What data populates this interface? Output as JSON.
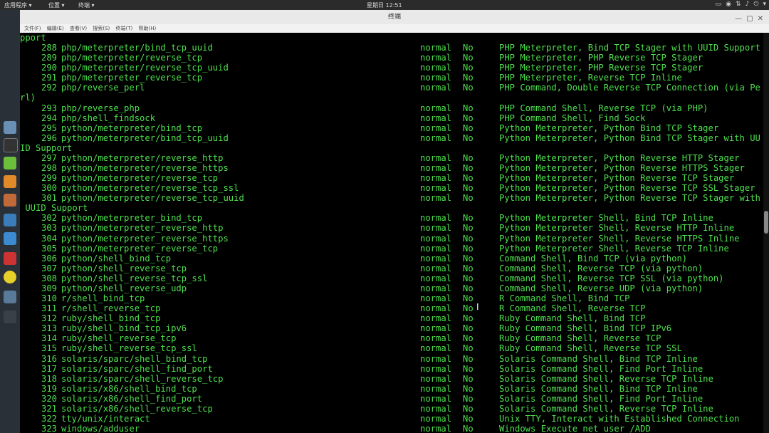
{
  "topbar": {
    "apps": "应用程序 ▾",
    "places": "位置 ▾",
    "terminal": "终端 ▾",
    "clock": "星期日 12:51"
  },
  "window": {
    "title": "终端",
    "menu": [
      "文件(F)",
      "编辑(E)",
      "查看(V)",
      "搜索(S)",
      "终端(T)",
      "帮助(H)"
    ]
  },
  "terminal": {
    "lines": [
      {
        "cont": "pport"
      },
      {
        "num": "288",
        "mod": "php/meterpreter/bind_tcp_uuid",
        "rank": "normal",
        "check": "No",
        "desc": "PHP Meterpreter, Bind TCP Stager with UUID Support"
      },
      {
        "num": "289",
        "mod": "php/meterpreter/reverse_tcp",
        "rank": "normal",
        "check": "No",
        "desc": "PHP Meterpreter, PHP Reverse TCP Stager"
      },
      {
        "num": "290",
        "mod": "php/meterpreter/reverse_tcp_uuid",
        "rank": "normal",
        "check": "No",
        "desc": "PHP Meterpreter, PHP Reverse TCP Stager"
      },
      {
        "num": "291",
        "mod": "php/meterpreter_reverse_tcp",
        "rank": "normal",
        "check": "No",
        "desc": "PHP Meterpreter, Reverse TCP Inline"
      },
      {
        "num": "292",
        "mod": "php/reverse_perl",
        "rank": "normal",
        "check": "No",
        "desc": "PHP Command, Double Reverse TCP Connection (via Pe"
      },
      {
        "cont": "rl)"
      },
      {
        "num": "293",
        "mod": "php/reverse_php",
        "rank": "normal",
        "check": "No",
        "desc": "PHP Command Shell, Reverse TCP (via PHP)"
      },
      {
        "num": "294",
        "mod": "php/shell_findsock",
        "rank": "normal",
        "check": "No",
        "desc": "PHP Command Shell, Find Sock"
      },
      {
        "num": "295",
        "mod": "python/meterpreter/bind_tcp",
        "rank": "normal",
        "check": "No",
        "desc": "Python Meterpreter, Python Bind TCP Stager"
      },
      {
        "num": "296",
        "mod": "python/meterpreter/bind_tcp_uuid",
        "rank": "normal",
        "check": "No",
        "desc": "Python Meterpreter, Python Bind TCP Stager with UU"
      },
      {
        "cont": "ID Support"
      },
      {
        "num": "297",
        "mod": "python/meterpreter/reverse_http",
        "rank": "normal",
        "check": "No",
        "desc": "Python Meterpreter, Python Reverse HTTP Stager"
      },
      {
        "num": "298",
        "mod": "python/meterpreter/reverse_https",
        "rank": "normal",
        "check": "No",
        "desc": "Python Meterpreter, Python Reverse HTTPS Stager"
      },
      {
        "num": "299",
        "mod": "python/meterpreter/reverse_tcp",
        "rank": "normal",
        "check": "No",
        "desc": "Python Meterpreter, Python Reverse TCP Stager"
      },
      {
        "num": "300",
        "mod": "python/meterpreter/reverse_tcp_ssl",
        "rank": "normal",
        "check": "No",
        "desc": "Python Meterpreter, Python Reverse TCP SSL Stager"
      },
      {
        "num": "301",
        "mod": "python/meterpreter/reverse_tcp_uuid",
        "rank": "normal",
        "check": "No",
        "desc": "Python Meterpreter, Python Reverse TCP Stager with"
      },
      {
        "cont": " UUID Support"
      },
      {
        "num": "302",
        "mod": "python/meterpreter_bind_tcp",
        "rank": "normal",
        "check": "No",
        "desc": "Python Meterpreter Shell, Bind TCP Inline"
      },
      {
        "num": "303",
        "mod": "python/meterpreter_reverse_http",
        "rank": "normal",
        "check": "No",
        "desc": "Python Meterpreter Shell, Reverse HTTP Inline"
      },
      {
        "num": "304",
        "mod": "python/meterpreter_reverse_https",
        "rank": "normal",
        "check": "No",
        "desc": "Python Meterpreter Shell, Reverse HTTPS Inline"
      },
      {
        "num": "305",
        "mod": "python/meterpreter_reverse_tcp",
        "rank": "normal",
        "check": "No",
        "desc": "Python Meterpreter Shell, Reverse TCP Inline"
      },
      {
        "num": "306",
        "mod": "python/shell_bind_tcp",
        "rank": "normal",
        "check": "No",
        "desc": "Command Shell, Bind TCP (via python)"
      },
      {
        "num": "307",
        "mod": "python/shell_reverse_tcp",
        "rank": "normal",
        "check": "No",
        "desc": "Command Shell, Reverse TCP (via python)"
      },
      {
        "num": "308",
        "mod": "python/shell_reverse_tcp_ssl",
        "rank": "normal",
        "check": "No",
        "desc": "Command Shell, Reverse TCP SSL (via python)"
      },
      {
        "num": "309",
        "mod": "python/shell_reverse_udp",
        "rank": "normal",
        "check": "No",
        "desc": "Command Shell, Reverse UDP (via python)"
      },
      {
        "num": "310",
        "mod": "r/shell_bind_tcp",
        "rank": "normal",
        "check": "No",
        "desc": "R Command Shell, Bind TCP"
      },
      {
        "num": "311",
        "mod": "r/shell_reverse_tcp",
        "rank": "normal",
        "check": "No",
        "desc": "R Command Shell, Reverse TCP"
      },
      {
        "num": "312",
        "mod": "ruby/shell_bind_tcp",
        "rank": "normal",
        "check": "No",
        "desc": "Ruby Command Shell, Bind TCP"
      },
      {
        "num": "313",
        "mod": "ruby/shell_bind_tcp_ipv6",
        "rank": "normal",
        "check": "No",
        "desc": "Ruby Command Shell, Bind TCP IPv6"
      },
      {
        "num": "314",
        "mod": "ruby/shell_reverse_tcp",
        "rank": "normal",
        "check": "No",
        "desc": "Ruby Command Shell, Reverse TCP"
      },
      {
        "num": "315",
        "mod": "ruby/shell_reverse_tcp_ssl",
        "rank": "normal",
        "check": "No",
        "desc": "Ruby Command Shell, Reverse TCP SSL"
      },
      {
        "num": "316",
        "mod": "solaris/sparc/shell_bind_tcp",
        "rank": "normal",
        "check": "No",
        "desc": "Solaris Command Shell, Bind TCP Inline"
      },
      {
        "num": "317",
        "mod": "solaris/sparc/shell_find_port",
        "rank": "normal",
        "check": "No",
        "desc": "Solaris Command Shell, Find Port Inline"
      },
      {
        "num": "318",
        "mod": "solaris/sparc/shell_reverse_tcp",
        "rank": "normal",
        "check": "No",
        "desc": "Solaris Command Shell, Reverse TCP Inline"
      },
      {
        "num": "319",
        "mod": "solaris/x86/shell_bind_tcp",
        "rank": "normal",
        "check": "No",
        "desc": "Solaris Command Shell, Bind TCP Inline"
      },
      {
        "num": "320",
        "mod": "solaris/x86/shell_find_port",
        "rank": "normal",
        "check": "No",
        "desc": "Solaris Command Shell, Find Port Inline"
      },
      {
        "num": "321",
        "mod": "solaris/x86/shell_reverse_tcp",
        "rank": "normal",
        "check": "No",
        "desc": "Solaris Command Shell, Reverse TCP Inline"
      },
      {
        "num": "322",
        "mod": "tty/unix/interact",
        "rank": "normal",
        "check": "No",
        "desc": "Unix TTY, Interact with Established Connection"
      },
      {
        "num": "323",
        "mod": "windows/adduser",
        "rank": "normal",
        "check": "No",
        "desc": "Windows Execute net user /ADD"
      }
    ]
  }
}
